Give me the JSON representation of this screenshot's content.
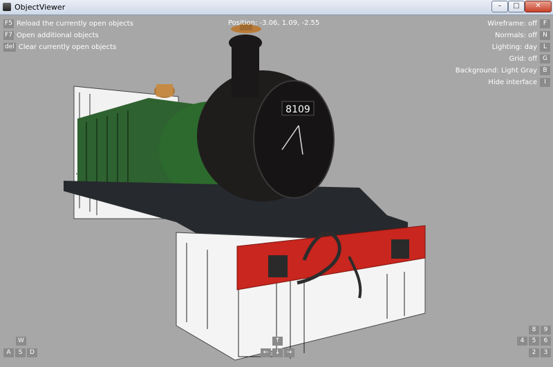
{
  "window": {
    "title": "ObjectViewer",
    "min_glyph": "–",
    "max_glyph": "□",
    "close_glyph": "✕"
  },
  "hud": {
    "left": [
      {
        "key": "F5",
        "label": "Reload the currently open objects"
      },
      {
        "key": "F7",
        "label": "Open additional objects"
      },
      {
        "key": "del",
        "label": "Clear currently open objects"
      }
    ],
    "position": "Position: -3.06, 1.09, -2.55",
    "right": [
      {
        "label": "Wireframe: off",
        "key": "F"
      },
      {
        "label": "Normals: off",
        "key": "N"
      },
      {
        "label": "Lighting: day",
        "key": "L"
      },
      {
        "label": "Grid: off",
        "key": "G"
      },
      {
        "label": "Background: Light Gray",
        "key": "B"
      },
      {
        "label": "Hide interface",
        "key": "I"
      }
    ]
  },
  "nav_left": {
    "w": "W",
    "a": "A",
    "s": "S",
    "d": "D"
  },
  "nav_center": {
    "up": "↑",
    "left": "←",
    "down": "↓",
    "right": "→"
  },
  "nav_right": {
    "k8": "8",
    "k9": "9",
    "k4": "4",
    "k5": "5",
    "k6": "6",
    "k2": "2",
    "k3": "3"
  },
  "model": {
    "number_plate": "8109"
  },
  "colors": {
    "boiler_green": "#2f6b2e",
    "smokebox": "#1c1a1a",
    "buffer_beam": "#c8261e",
    "background": "#a7a7a7",
    "hud_key": "#8b8b8b"
  }
}
